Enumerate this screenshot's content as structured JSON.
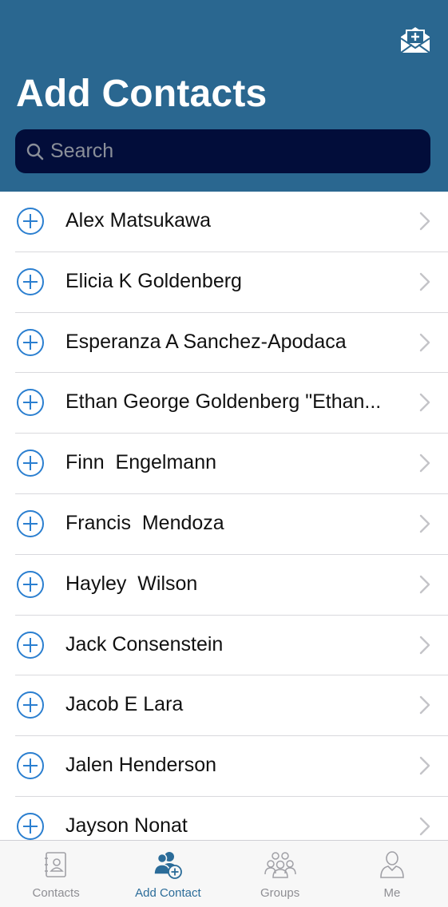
{
  "header": {
    "title": "Add Contacts",
    "action_icon": "envelope-add-icon"
  },
  "search": {
    "placeholder": "Search",
    "value": ""
  },
  "contacts": [
    {
      "name": "Alex Matsukawa"
    },
    {
      "name": "Elicia K Goldenberg"
    },
    {
      "name": "Esperanza A Sanchez-Apodaca"
    },
    {
      "name": "Ethan George Goldenberg \"Ethan..."
    },
    {
      "name": "Finn  Engelmann"
    },
    {
      "name": "Francis  Mendoza"
    },
    {
      "name": "Hayley  Wilson"
    },
    {
      "name": "Jack Consenstein"
    },
    {
      "name": "Jacob E Lara"
    },
    {
      "name": "Jalen Henderson"
    },
    {
      "name": "Jayson Nonat"
    }
  ],
  "tabs": [
    {
      "label": "Contacts",
      "icon": "address-book-icon",
      "active": false
    },
    {
      "label": "Add Contact",
      "icon": "add-person-icon",
      "active": true
    },
    {
      "label": "Groups",
      "icon": "group-icon",
      "active": false
    },
    {
      "label": "Me",
      "icon": "person-icon",
      "active": false
    }
  ],
  "colors": {
    "header_bg": "#2a6790",
    "search_bg": "#020d3a",
    "accent": "#2b7fd0",
    "tab_active": "#2b6c99",
    "tab_inactive": "#8e8e93"
  }
}
